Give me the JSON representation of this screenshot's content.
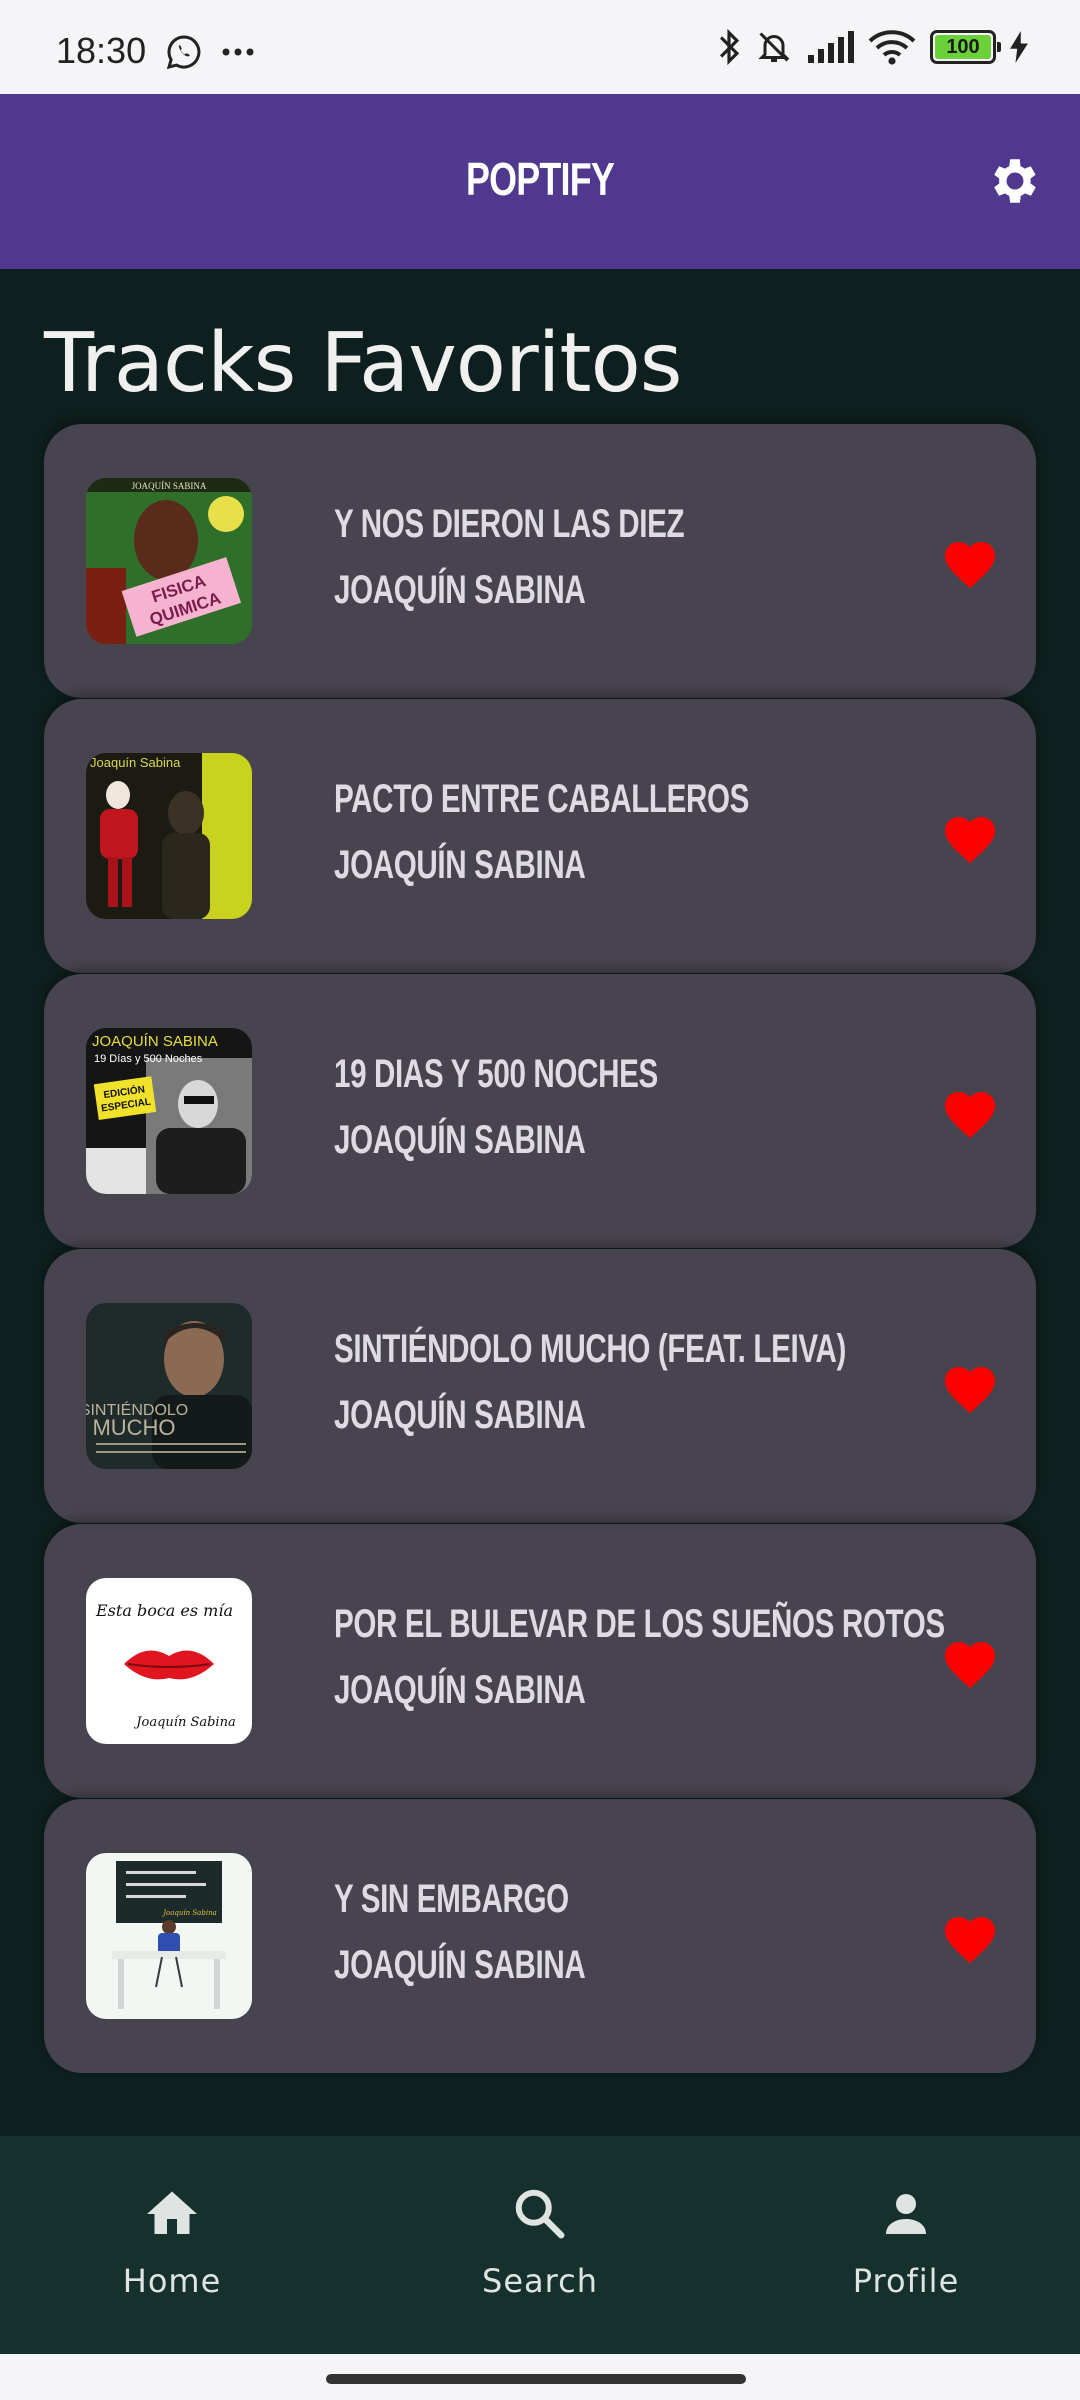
{
  "status_bar": {
    "time": "18:30",
    "battery": "100",
    "icons": [
      "whatsapp-icon",
      "more-dots-icon",
      "bluetooth-icon",
      "mute-bell-icon",
      "signal-icon",
      "wifi-icon",
      "battery-icon",
      "charging-icon"
    ]
  },
  "app_bar": {
    "title": "POPTIFY",
    "settings_icon": "gear-icon",
    "color": "#4f388d"
  },
  "page": {
    "heading": "Tracks Favoritos"
  },
  "tracks": [
    {
      "title": "Y NOS DIERON LAS DIEZ",
      "artist": "JOAQUÍN SABINA",
      "favorite": true
    },
    {
      "title": "PACTO ENTRE CABALLEROS",
      "artist": "JOAQUÍN SABINA",
      "favorite": true
    },
    {
      "title": "19 DIAS Y 500 NOCHES",
      "artist": "JOAQUÍN SABINA",
      "favorite": true
    },
    {
      "title": "SINTIÉNDOLO MUCHO (FEAT. LEIVA)",
      "artist": "JOAQUÍN SABINA",
      "favorite": true
    },
    {
      "title": "POR EL BULEVAR DE LOS SUEÑOS ROTOS",
      "artist": "JOAQUÍN SABINA",
      "favorite": true
    },
    {
      "title": "Y SIN EMBARGO",
      "artist": "JOAQUÍN SABINA",
      "favorite": true
    }
  ],
  "covers": {
    "cover1_lines": [
      "JOAQUÍN SABINA",
      "FISICA",
      "QUIMICA"
    ],
    "cover2_lines": [
      "Joaquín Sabina"
    ],
    "cover3_lines": [
      "JOAQUÍN SABINA",
      "19 Días y 500 Noches",
      "EDICIÓN",
      "ESPECIAL"
    ],
    "cover4_lines": [
      "SINTIÉNDOLO",
      "MUCHO"
    ],
    "cover5_lines": [
      "Esta boca es mía",
      "Joaquín Sabina"
    ],
    "cover6_lines": [
      "Joaquín Sabina"
    ]
  },
  "bottom_nav": [
    {
      "label": "Home",
      "icon": "home-icon"
    },
    {
      "label": "Search",
      "icon": "search-icon"
    },
    {
      "label": "Profile",
      "icon": "person-icon"
    }
  ],
  "colors": {
    "background": "#0d1f1e",
    "card": "#48444f",
    "heart": "#ff0000",
    "bottom_nav": "#16302d"
  }
}
